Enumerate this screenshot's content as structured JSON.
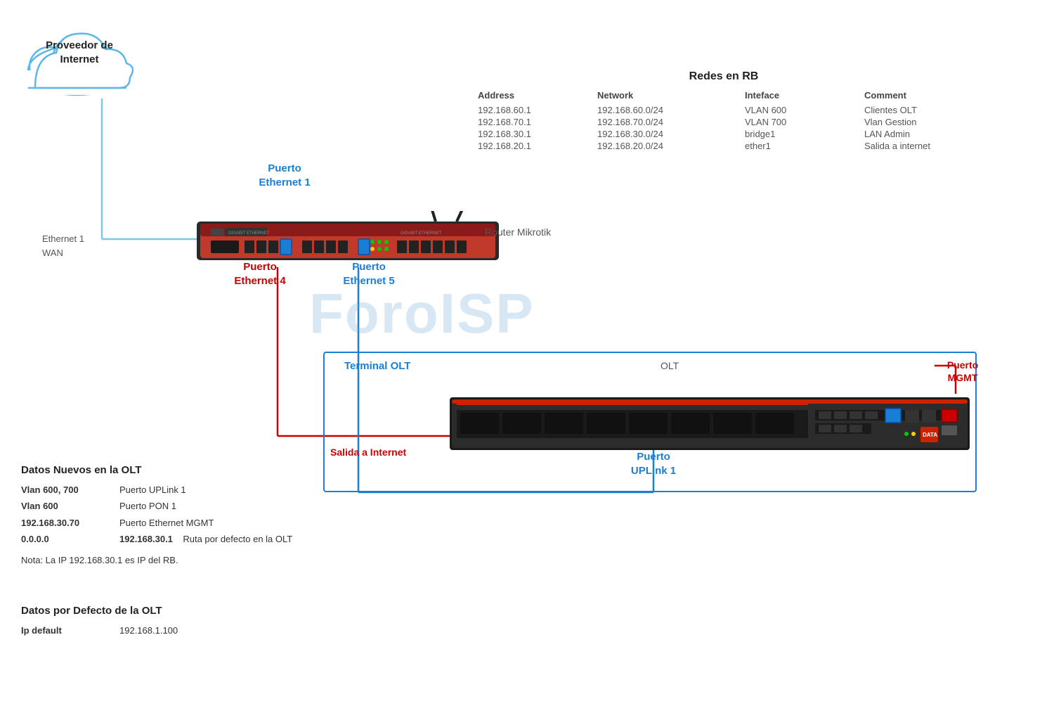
{
  "isp": {
    "label_line1": "Proveedor de",
    "label_line2": "Internet"
  },
  "eth1_wan": {
    "line1": "Ethernet 1",
    "line2": "WAN"
  },
  "router_label": "Router Mikrotik",
  "port_labels": {
    "ethernet1": "Puerto\nEthernet 1",
    "ethernet1_line1": "Puerto",
    "ethernet1_line2": "Ethernet 1",
    "ethernet4_line1": "Puerto",
    "ethernet4_line2": "Ethernet 4",
    "ethernet5_line1": "Puerto",
    "ethernet5_line2": "Ethernet 5",
    "mgmt_line1": "Puerto",
    "mgmt_line2": "MGMT",
    "uplink_line1": "Puerto",
    "uplink_line2": "UPLink 1"
  },
  "olt_label": "OLT",
  "terminal_olt_label": "Terminal OLT",
  "salida_internet": "Salida a Internet",
  "redes_rb": {
    "title": "Redes en RB",
    "headers": [
      "Address",
      "Network",
      "Inteface",
      "Comment"
    ],
    "rows": [
      [
        "192.168.60.1",
        "192.168.60.0/24",
        "VLAN 600",
        "Clientes OLT"
      ],
      [
        "192.168.70.1",
        "192.168.70.0/24",
        "VLAN 700",
        "Vlan Gestion"
      ],
      [
        "192.168.30.1",
        "192.168.30.0/24",
        "bridge1",
        "LAN Admin"
      ],
      [
        "192.168.20.1",
        "192.168.20.0/24",
        "ether1",
        "Salida a internet"
      ]
    ]
  },
  "datos_nuevos": {
    "title": "Datos Nuevos en  la OLT",
    "rows": [
      {
        "col1": "Vlan 600, 700",
        "col2": "Puerto UPLink 1"
      },
      {
        "col1": "Vlan 600",
        "col2": "Puerto PON 1"
      },
      {
        "col1": "192.168.30.70",
        "col2": "Puerto Ethernet MGMT"
      }
    ],
    "row_ruta": {
      "col1": "0.0.0.0",
      "col2": "192.168.30.1",
      "col3": "Ruta  por defecto en la OLT"
    },
    "note": "Nota: La IP 192.168.30.1 es IP del RB."
  },
  "datos_defecto": {
    "title": "Datos por Defecto de la OLT",
    "rows": [
      {
        "col1": "Ip default",
        "col2": "192.168.1.100"
      }
    ]
  },
  "watermark": "ForoISP"
}
